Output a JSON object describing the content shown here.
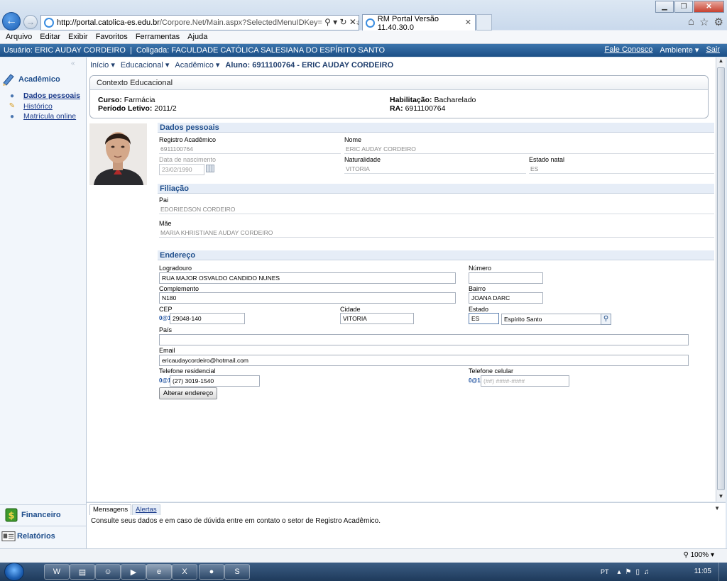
{
  "browser": {
    "url_host": "http://portal.catolica-es.edu.br",
    "url_rest": "/Corpore.Net/Main.aspx?SelectedMenuIDKey=MainEduca",
    "tab_title": "RM Portal Versão 11.40.30.0",
    "menu": [
      "Arquivo",
      "Editar",
      "Exibir",
      "Favoritos",
      "Ferramentas",
      "Ajuda"
    ]
  },
  "header": {
    "user": "Usuário: ERIC AUDAY CORDEIRO",
    "separator": "|",
    "coligada": "Coligada: FACULDADE CATÓLICA SALESIANA DO ESPÍRITO SANTO",
    "contact": "Fale Conosco",
    "environment": "Ambiente ▾",
    "logout": "Sair"
  },
  "sidebar": {
    "collapse": "«",
    "section_academico": "Acadêmico",
    "items": [
      {
        "label": "Dados pessoais",
        "icon": "user-icon"
      },
      {
        "label": "Histórico",
        "icon": "pencil-icon"
      },
      {
        "label": "Matrícula online",
        "icon": "enroll-icon"
      }
    ],
    "section_financeiro": "Financeiro",
    "section_relatorios": "Relatórios"
  },
  "breadcrumb": {
    "inicio": "Início ▾",
    "educacional": "Educacional ▾",
    "academico": "Acadêmico ▾",
    "student": "Aluno: 6911100764 - ERIC AUDAY CORDEIRO"
  },
  "context": {
    "title": "Contexto Educacional",
    "curso_label": "Curso:",
    "curso_value": "Farmácia",
    "periodo_label": "Período Letivo:",
    "periodo_value": "2011/2",
    "habilitacao_label": "Habilitação:",
    "habilitacao_value": "Bacharelado",
    "ra_label": "RA:",
    "ra_value": "6911100764"
  },
  "dados_pessoais": {
    "title": "Dados pessoais",
    "registro_label": "Registro Acadêmico",
    "registro_value": "6911100764",
    "nome_label": "Nome",
    "nome_value": "ERIC AUDAY CORDEIRO",
    "nascimento_label": "Data de nascimento",
    "nascimento_value": "23/02/1990",
    "naturalidade_label": "Naturalidade",
    "naturalidade_value": "VITORIA",
    "estado_natal_label": "Estado natal",
    "estado_natal_value": "ES"
  },
  "filiacao": {
    "title": "Filiação",
    "pai_label": "Pai",
    "pai_value": "EDORIEDSON CORDEIRO",
    "mae_label": "Mãe",
    "mae_value": "MARIA KHRISTIANE AUDAY CORDEIRO"
  },
  "endereco": {
    "title": "Endereço",
    "logradouro_label": "Logradouro",
    "logradouro_value": "RUA MAJOR OSVALDO CANDIDO NUNES",
    "numero_label": "Número",
    "numero_value": "",
    "complemento_label": "Complemento",
    "complemento_value": "N180",
    "bairro_label": "Bairro",
    "bairro_value": "JOANA DARC",
    "cep_label": "CEP",
    "cep_value": "29048-140",
    "cidade_label": "Cidade",
    "cidade_value": "VITORIA",
    "estado_label": "Estado",
    "estado_code": "ES",
    "estado_name": "Espírito Santo",
    "pais_label": "País",
    "pais_value": "",
    "email_label": "Email",
    "email_value": "ericaudaycordeiro@hotmail.com",
    "tel_res_label": "Telefone residencial",
    "tel_res_value": "(27) 3019-1540",
    "tel_cel_label": "Telefone celular",
    "tel_cel_placeholder": "(##) ####-####",
    "mask_icon": "0@1",
    "button_label": "Alterar endereço"
  },
  "messages": {
    "tab_mensagens": "Mensagens",
    "tab_alertas": "Alertas",
    "text": "Consulte seus dados e em caso de dúvida entre em contato o setor de Registro Acadêmico."
  },
  "statusbar": {
    "zoom": "100%"
  },
  "taskbar": {
    "lang": "PT",
    "time": "11:05"
  },
  "colors": {
    "header_blue": "#1c4f86",
    "section_blue": "#1f4e8c",
    "link_blue": "#1a3a8a"
  }
}
